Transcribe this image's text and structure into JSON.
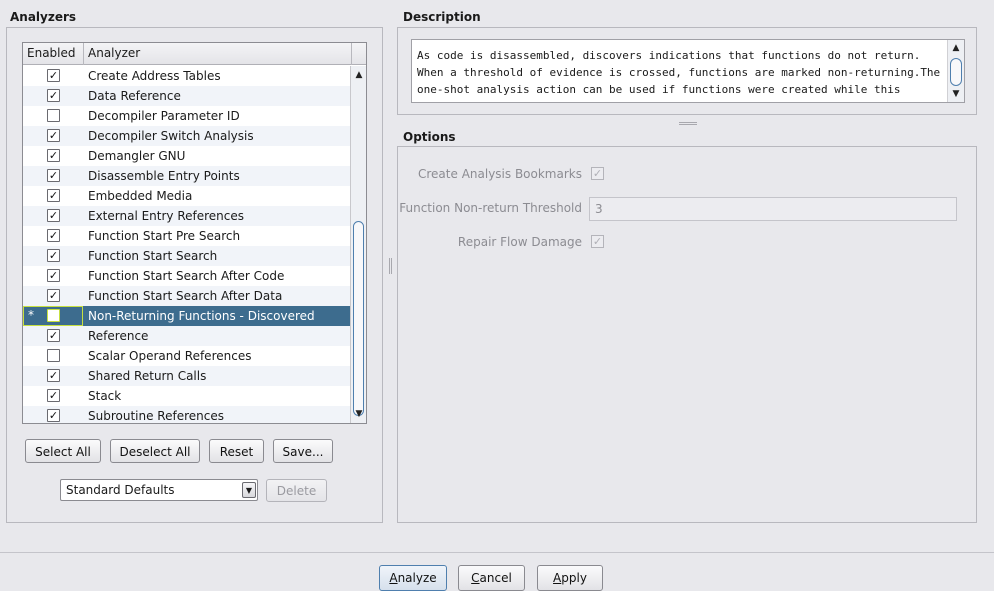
{
  "analyzers": {
    "title": "Analyzers",
    "columns": [
      "Enabled",
      "Analyzer"
    ],
    "rows": [
      {
        "name": "Create Address Tables",
        "enabled": true
      },
      {
        "name": "Data Reference",
        "enabled": true
      },
      {
        "name": "Decompiler Parameter ID",
        "enabled": false
      },
      {
        "name": "Decompiler Switch Analysis",
        "enabled": true
      },
      {
        "name": "Demangler GNU",
        "enabled": true
      },
      {
        "name": "Disassemble Entry Points",
        "enabled": true
      },
      {
        "name": "Embedded Media",
        "enabled": true
      },
      {
        "name": "External Entry References",
        "enabled": true
      },
      {
        "name": "Function Start Pre Search",
        "enabled": true
      },
      {
        "name": "Function Start Search",
        "enabled": true
      },
      {
        "name": "Function Start Search After Code",
        "enabled": true
      },
      {
        "name": "Function Start Search After Data",
        "enabled": true
      },
      {
        "name": "Non-Returning Functions - Discovered",
        "enabled": false,
        "selected": true,
        "modified_mark": "*"
      },
      {
        "name": "Reference",
        "enabled": true
      },
      {
        "name": "Scalar Operand References",
        "enabled": false
      },
      {
        "name": "Shared Return Calls",
        "enabled": true
      },
      {
        "name": "Stack",
        "enabled": true
      },
      {
        "name": "Subroutine References",
        "enabled": true
      }
    ],
    "buttons": {
      "select_all": "Select All",
      "deselect_all": "Deselect All",
      "reset": "Reset",
      "save": "Save..."
    },
    "profile": {
      "selected": "Standard Defaults",
      "delete_label": "Delete"
    }
  },
  "description": {
    "title": "Description",
    "text": "As code is disassembled, discovers indications that functions do not return.  When a threshold of evidence is crossed, functions are marked non-returning.The one-shot analysis action can be used if functions were created while this analyzer was disabled or not present."
  },
  "options": {
    "title": "Options",
    "create_bookmarks": {
      "label": "Create Analysis Bookmarks",
      "checked": true
    },
    "threshold": {
      "label": "Function Non-return Threshold",
      "value": "3"
    },
    "repair_flow": {
      "label": "Repair Flow Damage",
      "checked": true
    }
  },
  "footer": {
    "analyze": {
      "prefix": "",
      "mnemonic": "A",
      "rest": "nalyze"
    },
    "cancel": {
      "prefix": "",
      "mnemonic": "C",
      "rest": "ancel"
    },
    "apply": {
      "prefix": "",
      "mnemonic": "A",
      "rest": "pply"
    }
  },
  "colors": {
    "selection": "#3d6c8e",
    "accent": "#4f7fae",
    "alt_row": "#f1f4f9"
  },
  "icons": {
    "check": "✓",
    "scroll_up": "▲",
    "scroll_down": "▼",
    "dropdown": "▼"
  }
}
